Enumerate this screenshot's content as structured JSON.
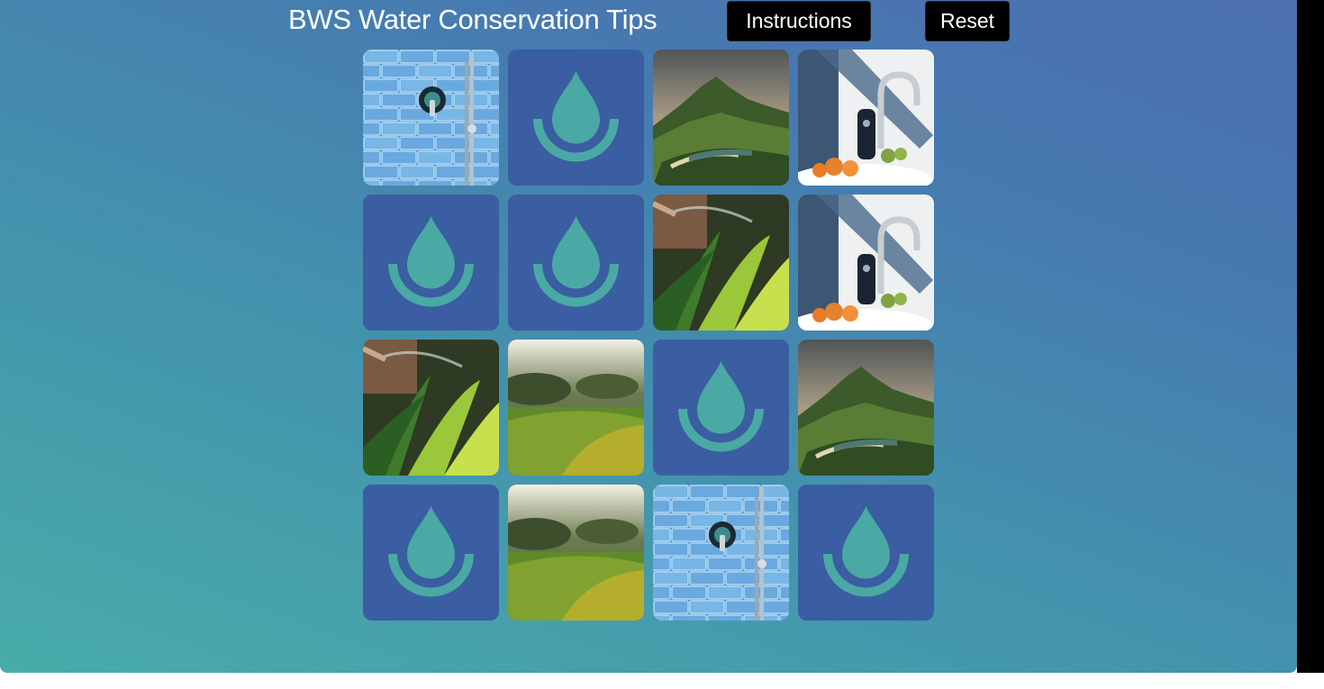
{
  "header": {
    "title": "BWS Water Conservation Tips",
    "instructions_label": "Instructions",
    "reset_label": "Reset"
  },
  "board": {
    "rows": 4,
    "cols": 4,
    "cards": [
      {
        "state": "face-up",
        "image": "shower-tile"
      },
      {
        "state": "face-down",
        "image": "drop-logo"
      },
      {
        "state": "face-up",
        "image": "mountain-bay"
      },
      {
        "state": "face-up",
        "image": "faucet-bottle"
      },
      {
        "state": "face-down",
        "image": "drop-logo"
      },
      {
        "state": "face-down",
        "image": "drop-logo"
      },
      {
        "state": "face-up",
        "image": "garden-hose"
      },
      {
        "state": "face-up",
        "image": "faucet-bottle"
      },
      {
        "state": "face-up",
        "image": "garden-hose"
      },
      {
        "state": "face-up",
        "image": "grass-sunset"
      },
      {
        "state": "face-down",
        "image": "drop-logo"
      },
      {
        "state": "face-up",
        "image": "mountain-bay"
      },
      {
        "state": "face-down",
        "image": "drop-logo"
      },
      {
        "state": "face-up",
        "image": "grass-sunset"
      },
      {
        "state": "face-up",
        "image": "shower-tile"
      },
      {
        "state": "face-down",
        "image": "drop-logo"
      }
    ]
  },
  "colors": {
    "card_back": "#3a5ea1",
    "drop": "#4aa9a4",
    "button_bg": "#000000",
    "title_text": "#ffffff"
  }
}
